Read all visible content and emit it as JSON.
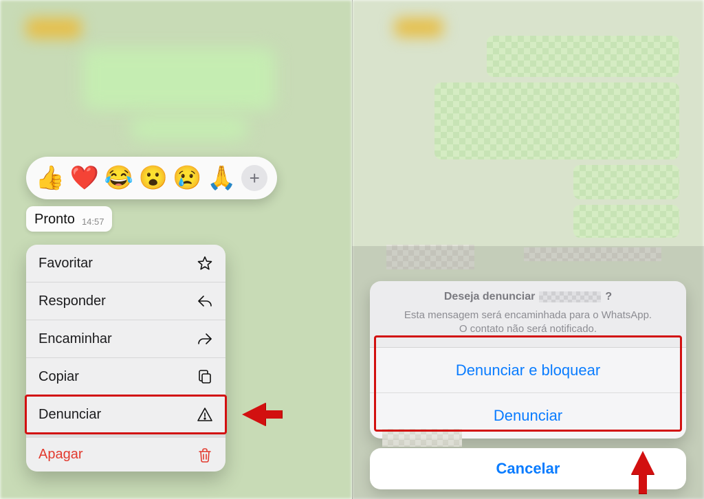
{
  "left": {
    "reactions": [
      "👍",
      "❤️",
      "😂",
      "😮",
      "😢",
      "🙏"
    ],
    "reaction_add_label": "+",
    "message": {
      "text": "Pronto",
      "time": "14:57"
    },
    "menu": {
      "favoritar": "Favoritar",
      "responder": "Responder",
      "encaminhar": "Encaminhar",
      "copiar": "Copiar",
      "denunciar": "Denunciar",
      "apagar": "Apagar"
    }
  },
  "right": {
    "sheet": {
      "title_prefix": "Deseja denunciar",
      "title_suffix": "?",
      "subtitle_line1": "Esta mensagem será encaminhada para o WhatsApp.",
      "subtitle_line2": "O contato não será notificado.",
      "btn_block": "Denunciar e bloquear",
      "btn_report": "Denunciar",
      "btn_cancel": "Cancelar"
    }
  }
}
